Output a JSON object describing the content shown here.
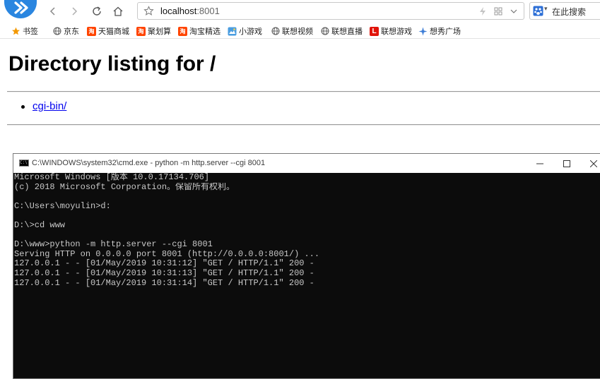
{
  "browser": {
    "address": {
      "host": "localhost",
      "port": ":8001"
    },
    "search_placeholder": "在此搜索",
    "bookmarks": [
      {
        "label": "书签",
        "icon": "star-icon"
      },
      {
        "label": "京东",
        "icon": "globe-icon"
      },
      {
        "label": "天猫商城",
        "icon": "tmall-icon"
      },
      {
        "label": "聚划算",
        "icon": "tmall-icon"
      },
      {
        "label": "淘宝精选",
        "icon": "tmall-icon"
      },
      {
        "label": "小游戏",
        "icon": "game-icon"
      },
      {
        "label": "联想视频",
        "icon": "globe-icon"
      },
      {
        "label": "联想直播",
        "icon": "globe-icon"
      },
      {
        "label": "联想游戏",
        "icon": "lenovo-icon"
      },
      {
        "label": "想秀广场",
        "icon": "sparkle-icon"
      }
    ]
  },
  "page": {
    "title": "Directory listing for /",
    "entries": [
      {
        "label": "cgi-bin/"
      }
    ]
  },
  "cmd": {
    "title": "C:\\WINDOWS\\system32\\cmd.exe - python  -m http.server --cgi 8001",
    "icon_label": "C:\\",
    "lines": [
      "Microsoft Windows [版本 10.0.17134.706]",
      "(c) 2018 Microsoft Corporation。保留所有权利。",
      "",
      "C:\\Users\\moyulin>d:",
      "",
      "D:\\>cd www",
      "",
      "D:\\www>python -m http.server --cgi 8001",
      "Serving HTTP on 0.0.0.0 port 8001 (http://0.0.0.0:8001/) ...",
      "127.0.0.1 - - [01/May/2019 10:31:12] \"GET / HTTP/1.1\" 200 -",
      "127.0.0.1 - - [01/May/2019 10:31:13] \"GET / HTTP/1.1\" 200 -",
      "127.0.0.1 - - [01/May/2019 10:31:14] \"GET / HTTP/1.1\" 200 -"
    ]
  },
  "colors": {
    "brand": "#2a86e0",
    "link": "#0000ee",
    "console_bg": "#0c0c0c",
    "console_text": "#c8c8c8"
  }
}
